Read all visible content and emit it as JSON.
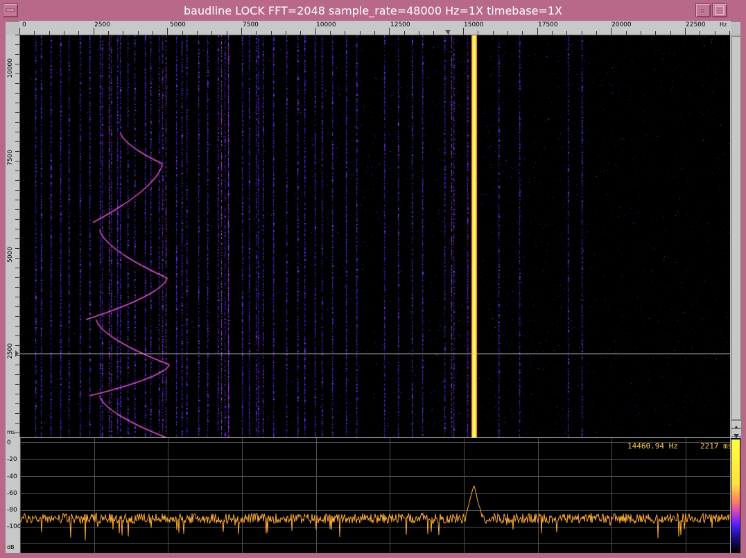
{
  "window": {
    "title": "baudline  LOCK FFT=2048 sample_rate=48000 Hz=1X timebase=1X"
  },
  "freq_axis": {
    "unit": "Hz",
    "ticks": [
      "0",
      "2500",
      "5000",
      "7500",
      "10000",
      "12500",
      "15000",
      "17500",
      "20000",
      "22500"
    ]
  },
  "time_axis": {
    "unit": "ms",
    "ticks": [
      "10000",
      "7500",
      "5000",
      "2500"
    ]
  },
  "spectrum": {
    "db_unit": "dB",
    "db_ticks": [
      "0",
      "-20",
      "-40",
      "-60",
      "-80",
      "-100"
    ],
    "readout_freq": "14460.94 Hz",
    "readout_time": "2217 ms"
  },
  "colors": {
    "titlebar": "#b86888",
    "spectrogram_bg": "#000000",
    "tone_line": "#ffff40",
    "noise": "#4020c0",
    "trace": "#ffaa33"
  },
  "icons": {
    "window_menu": "window-menu-icon",
    "minimize": "minimize-icon",
    "maximize": "maximize-icon"
  }
}
